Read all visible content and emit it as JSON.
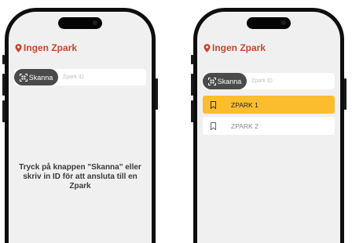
{
  "screens": [
    {
      "title": "Ingen Zpark",
      "scan_label": "Skanna",
      "id_placeholder": "Zpark ID",
      "message": "Tryck på knappen \"Skanna\" eller skriv in ID för att ansluta till en Zpark"
    },
    {
      "title": "Ingen Zpark",
      "scan_label": "Skanna",
      "id_placeholder": "Zpark ID",
      "list": [
        {
          "label": "ZPARK 1",
          "selected": true
        },
        {
          "label": "ZPARK 2",
          "selected": false
        }
      ]
    }
  ],
  "colors": {
    "title": "#c8462e",
    "selected": "#fbbd2d",
    "scan_button": "#4a4a4a"
  },
  "icons": {
    "title": "location-pin-icon",
    "scan": "qr-scan-icon",
    "list_item": "bookmark-icon"
  }
}
